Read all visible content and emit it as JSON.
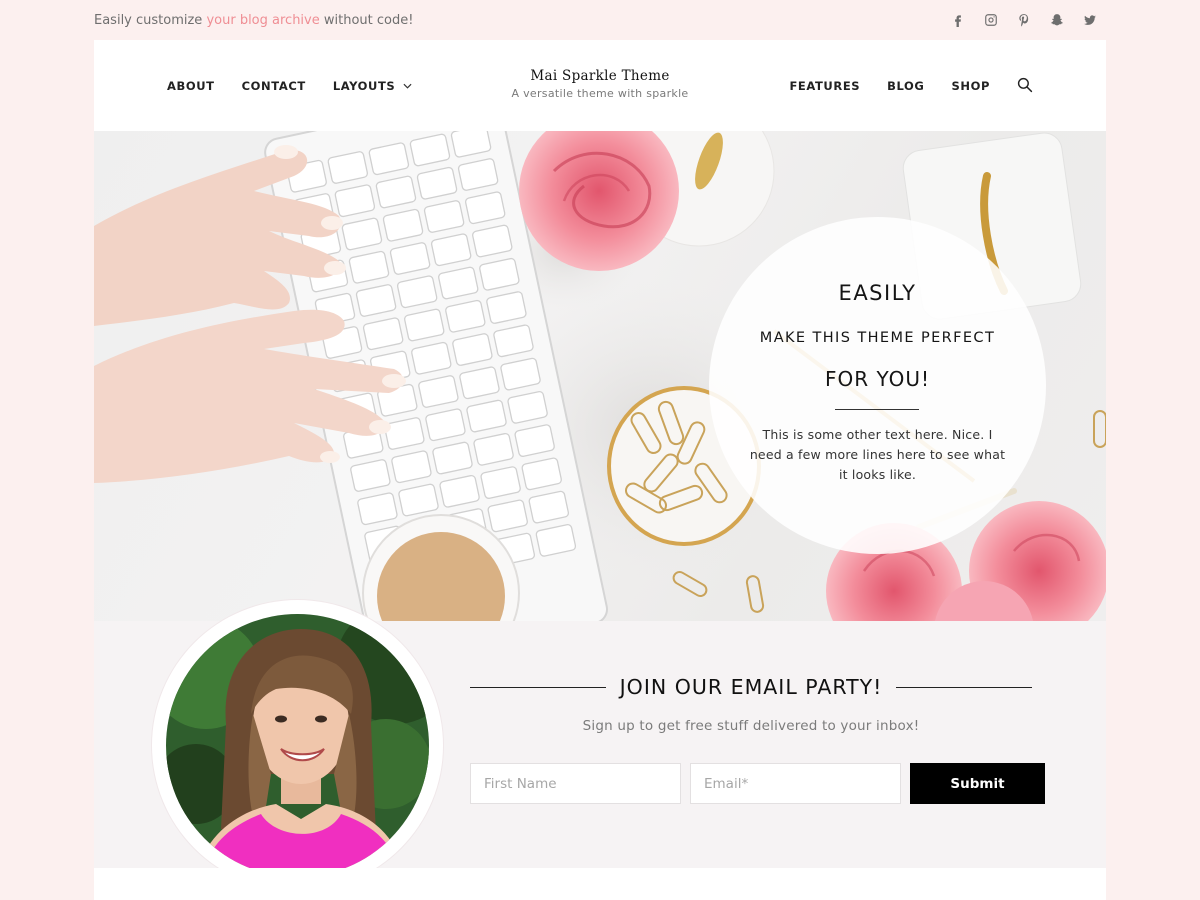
{
  "topbar": {
    "text_before": "Easily customize ",
    "link": "your blog archive",
    "text_after": " without code!",
    "social": [
      "facebook-icon",
      "instagram-icon",
      "pinterest-icon",
      "snapchat-icon",
      "twitter-icon"
    ]
  },
  "header": {
    "nav_left": [
      {
        "label": "About"
      },
      {
        "label": "Contact"
      },
      {
        "label": "Layouts"
      }
    ],
    "nav_right": [
      {
        "label": "Features"
      },
      {
        "label": "Blog"
      },
      {
        "label": "Shop"
      }
    ],
    "site_title": "Mai Sparkle Theme",
    "tagline": "A versatile theme with sparkle"
  },
  "hero": {
    "line1": "EASILY",
    "line2": "MAKE THIS THEME PERFECT",
    "line3": "FOR YOU!",
    "text": "This is some other text here. Nice. I need a few more lines here to see what it looks like."
  },
  "email": {
    "title": "JOIN OUR EMAIL PARTY!",
    "subtitle": "Sign up to get free stuff delivered to your inbox!",
    "first_name_placeholder": "First Name",
    "email_placeholder": "Email*",
    "submit_label": "Submit"
  },
  "colors": {
    "page_background": "#fcf0ef",
    "accent_link": "#ef8e94",
    "button_background": "#000000"
  }
}
